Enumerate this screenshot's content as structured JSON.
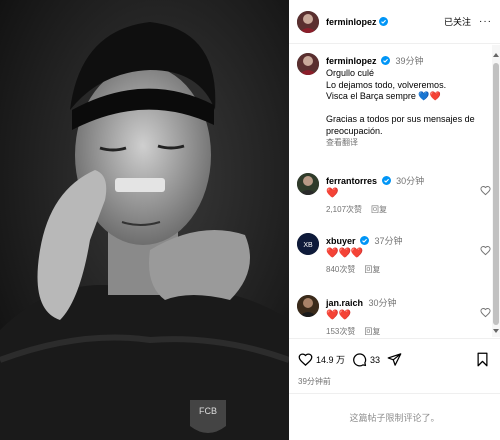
{
  "post": {
    "author": "ferminlopez",
    "follow_status": "已关注",
    "caption_time": "39分钟",
    "caption_lines": [
      "Orgullo culé",
      "Lo dejamos todo, volveremos.",
      "Visca el Barça sempre 💙❤️",
      "",
      "Gracias a todos por sus mensajes de preocupación."
    ],
    "translate_label": "查看翻译",
    "image_label": "FCB"
  },
  "comments": [
    {
      "user": "ferrantorres",
      "verified": true,
      "time": "30分钟",
      "text": "❤️",
      "likes": "2,107次赞",
      "reply": "回复"
    },
    {
      "user": "xbuyer",
      "verified": true,
      "time": "37分钟",
      "text": "❤️❤️❤️",
      "likes": "840次赞",
      "reply": "回复"
    },
    {
      "user": "jan.raich",
      "verified": false,
      "time": "30分钟",
      "text": "❤️❤️",
      "likes": "153次赞",
      "reply": "回复"
    }
  ],
  "actions": {
    "likes": "14.9 万",
    "comments": "33",
    "posted": "39分钟前"
  },
  "restricted_notice": "这篇帖子限制评论了。",
  "colors": {
    "verified": "#0095f6",
    "heart": "#ed4956",
    "muted": "#737373"
  },
  "icons": [
    "heart-icon",
    "comment-icon",
    "share-icon",
    "bookmark-icon",
    "more-icon",
    "verified-badge-icon"
  ]
}
